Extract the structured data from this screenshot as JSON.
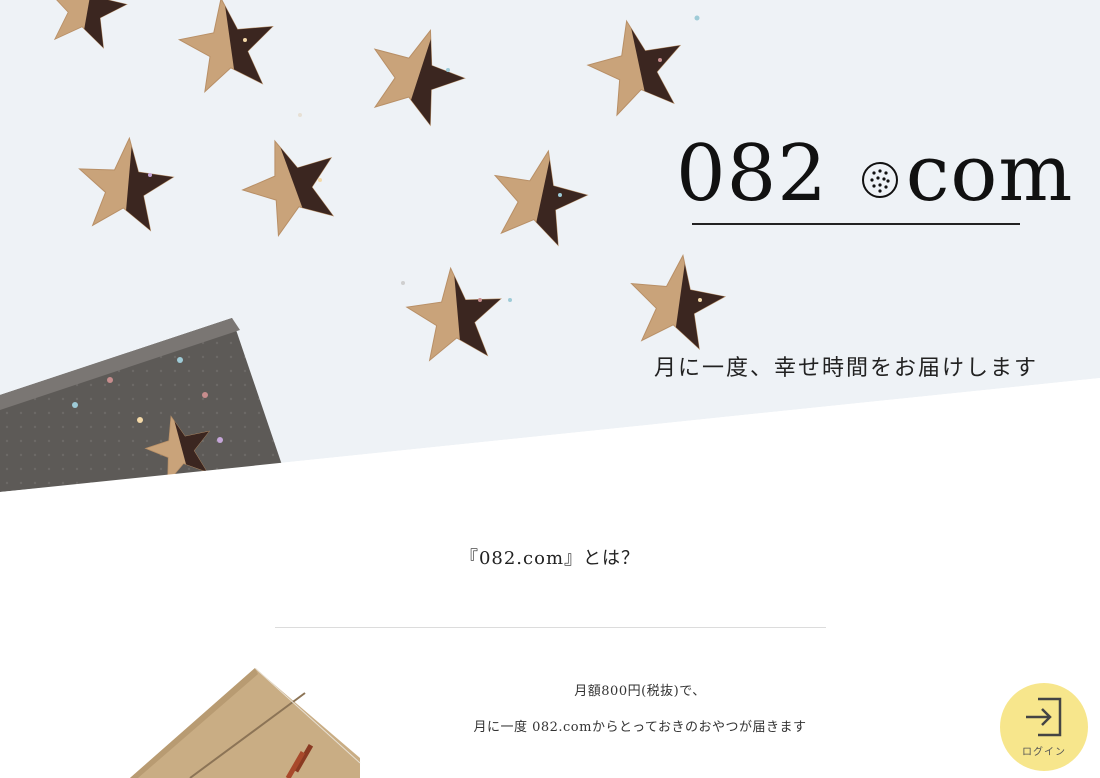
{
  "hero": {
    "logo_prefix": "082",
    "logo_suffix": "com",
    "tagline": "月に一度、幸せ時間をお届けします"
  },
  "about": {
    "heading": "『082.com』とは？",
    "line1": "月額800円(税抜)で、",
    "line2": "月に一度 082.comからとっておきのおやつが届きます"
  },
  "login": {
    "label": "ログイン",
    "icon": "login-arrow-icon"
  },
  "colors": {
    "login_bg": "#f7e68c",
    "cookie": "#c9a37a",
    "chocolate": "#3b2620",
    "tray": "#5d5a57"
  }
}
